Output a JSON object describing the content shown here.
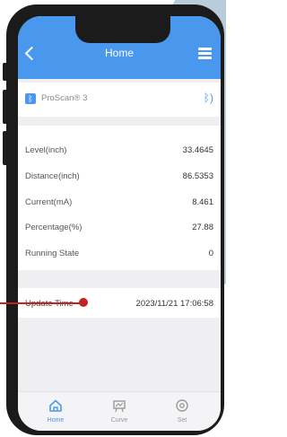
{
  "header": {
    "title": "Home"
  },
  "device": {
    "name": "ProScan® 3"
  },
  "readings": [
    {
      "label": "Level(inch)",
      "value": "33.4645"
    },
    {
      "label": "Distance(inch)",
      "value": "86.5353"
    },
    {
      "label": "Current(mA)",
      "value": "8.461"
    },
    {
      "label": "Percentage(%)",
      "value": "27.88"
    },
    {
      "label": "Running State",
      "value": "0"
    }
  ],
  "update": {
    "label": "Update Time",
    "value": "2023/11/21 17:06:58"
  },
  "tabs": [
    {
      "label": "Home",
      "icon": "home-icon",
      "active": true
    },
    {
      "label": "Curve",
      "icon": "curve-icon",
      "active": false
    },
    {
      "label": "Set",
      "icon": "settings-icon",
      "active": false
    }
  ],
  "colors": {
    "accent": "#4a98ee",
    "pointer": "#c02424"
  }
}
